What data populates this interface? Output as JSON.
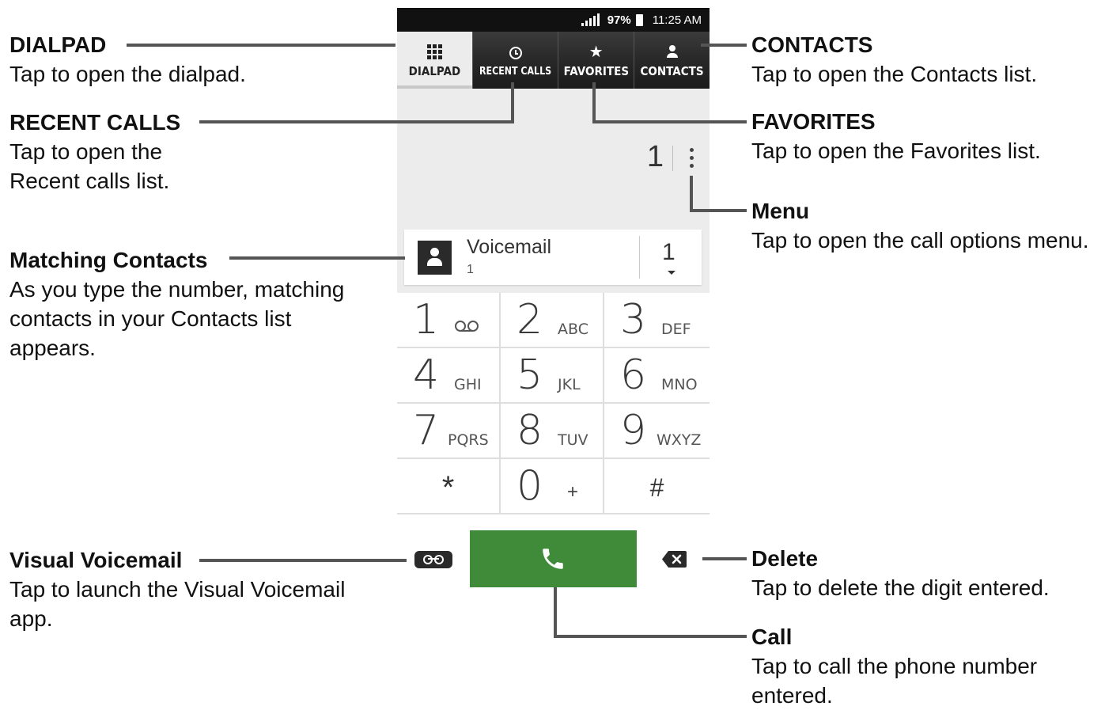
{
  "status_bar": {
    "battery": "97%",
    "time": "11:25 AM"
  },
  "tabs": [
    {
      "label": "DIALPAD",
      "icon": "dialpad-grid-icon",
      "active": true
    },
    {
      "label": "RECENT CALLS",
      "icon": "clock-icon",
      "active": false
    },
    {
      "label": "FAVORITES",
      "icon": "star-icon",
      "active": false
    },
    {
      "label": "CONTACTS",
      "icon": "person-icon",
      "active": false
    }
  ],
  "dial_display": {
    "digits": "1"
  },
  "matching_contact": {
    "name": "Voicemail",
    "number": "1",
    "count": "1"
  },
  "keypad": [
    {
      "digit": "1",
      "letters": "ꝏ"
    },
    {
      "digit": "2",
      "letters": "ABC"
    },
    {
      "digit": "3",
      "letters": "DEF"
    },
    {
      "digit": "4",
      "letters": "GHI"
    },
    {
      "digit": "5",
      "letters": "JKL"
    },
    {
      "digit": "6",
      "letters": "MNO"
    },
    {
      "digit": "7",
      "letters": "PQRS"
    },
    {
      "digit": "8",
      "letters": "TUV"
    },
    {
      "digit": "9",
      "letters": "WXYZ"
    },
    {
      "digit": "*",
      "letters": ""
    },
    {
      "digit": "0",
      "letters": "+"
    },
    {
      "digit": "#",
      "letters": ""
    }
  ],
  "colors": {
    "call_button": "#3f8b3a",
    "tab_bar": "#2a2a2a",
    "display_bg": "#ececec"
  },
  "callouts": {
    "dialpad": {
      "title": "DIALPAD",
      "desc": "Tap to open the dialpad."
    },
    "recent": {
      "title": "RECENT CALLS",
      "desc1": "Tap to open the",
      "desc2": "Recent calls list."
    },
    "matching": {
      "title": "Matching Contacts",
      "desc1": "As you type the number, matching",
      "desc2": "contacts in your Contacts list",
      "desc3": "appears."
    },
    "visual_vm": {
      "title": "Visual Voicemail",
      "desc1": "Tap to launch the Visual Voicemail",
      "desc2": "app."
    },
    "contacts": {
      "title": "CONTACTS",
      "desc": "Tap to open the Contacts list."
    },
    "favorites": {
      "title": "FAVORITES",
      "desc": "Tap to open the Favorites list."
    },
    "menu": {
      "title": "Menu",
      "desc": "Tap to open the call options menu."
    },
    "delete": {
      "title": "Delete",
      "desc": "Tap to delete the digit entered."
    },
    "call": {
      "title": "Call",
      "desc1": "Tap to call the phone number",
      "desc2": "entered."
    }
  }
}
